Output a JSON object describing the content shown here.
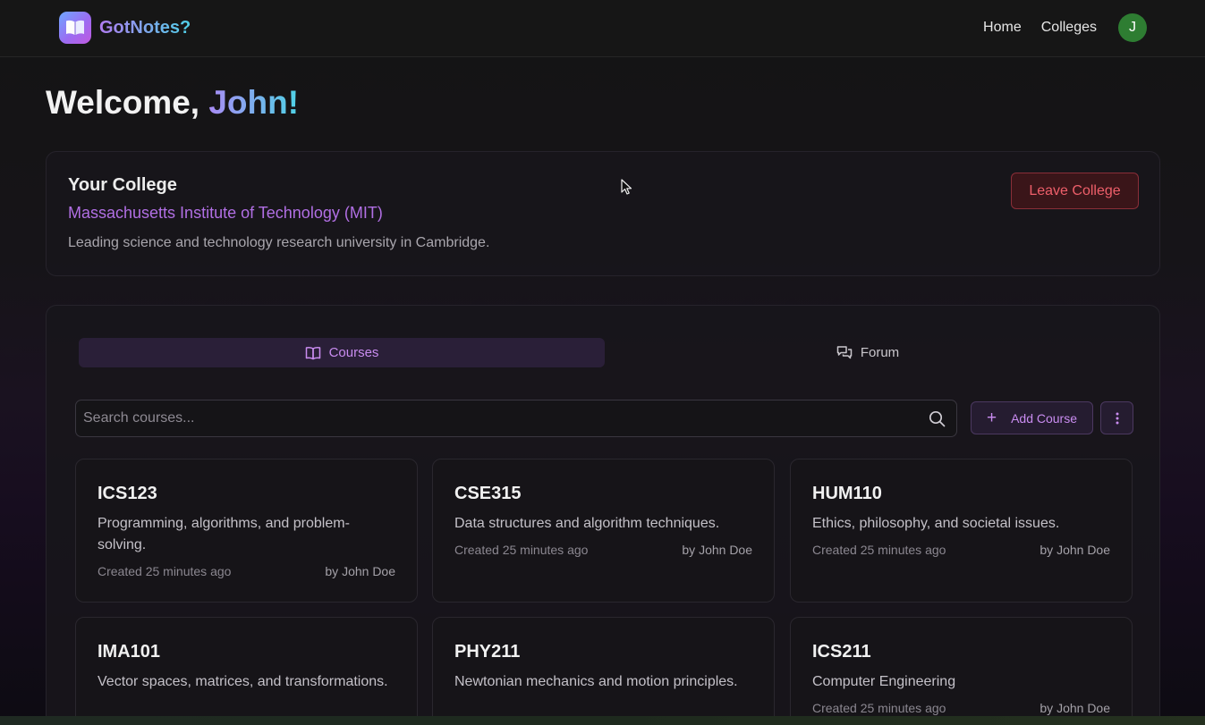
{
  "brand": {
    "name": "GotNotes?"
  },
  "nav": {
    "links": [
      "Home",
      "Colleges"
    ],
    "avatar_initial": "J"
  },
  "welcome": {
    "prefix": "Welcome, ",
    "name": "John!"
  },
  "college": {
    "heading": "Your College",
    "name": "Massachusetts Institute of Technology (MIT)",
    "description": "Leading science and technology research university in Cambridge.",
    "leave_label": "Leave College"
  },
  "tabs": [
    {
      "label": "Courses",
      "icon": "book-open-icon",
      "active": true
    },
    {
      "label": "Forum",
      "icon": "chat-bubbles-icon",
      "active": false
    }
  ],
  "search": {
    "placeholder": "Search courses...",
    "value": ""
  },
  "actions": {
    "add_course_label": "Add Course",
    "more_icon": "vertical-dots-icon"
  },
  "courses": [
    {
      "code": "ICS123",
      "description": "Programming, algorithms, and problem-solving.",
      "created": "Created 25 minutes ago",
      "author": "by John Doe"
    },
    {
      "code": "CSE315",
      "description": "Data structures and algorithm techniques.",
      "created": "Created 25 minutes ago",
      "author": "by John Doe"
    },
    {
      "code": "HUM110",
      "description": "Ethics, philosophy, and societal issues.",
      "created": "Created 25 minutes ago",
      "author": "by John Doe"
    },
    {
      "code": "IMA101",
      "description": "Vector spaces, matrices, and transformations.",
      "created": "",
      "author": ""
    },
    {
      "code": "PHY211",
      "description": "Newtonian mechanics and motion principles.",
      "created": "",
      "author": ""
    },
    {
      "code": "ICS211",
      "description": "Computer Engineering",
      "created": "Created 25 minutes ago",
      "author": "by John Doe"
    }
  ],
  "colors": {
    "accent_purple": "#c98cf0",
    "danger": "#ee5f6a",
    "avatar_green": "#2e7d32"
  }
}
